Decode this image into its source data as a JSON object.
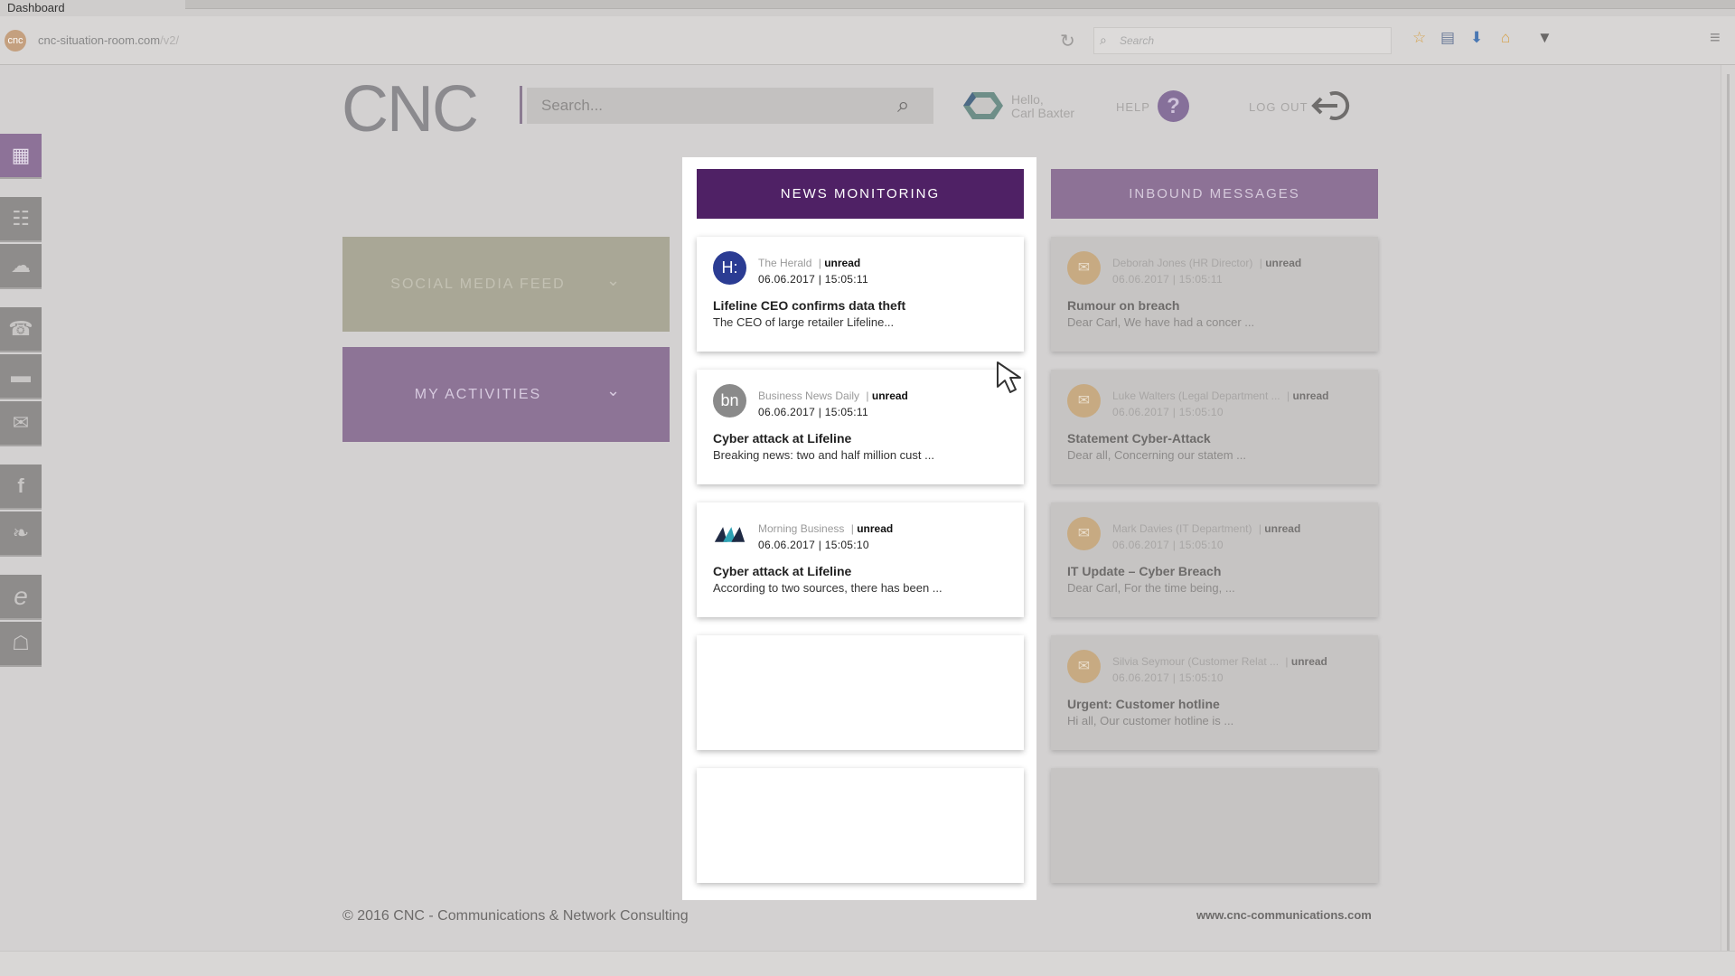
{
  "browser": {
    "window_title": "Dashboard",
    "favicon_glyph": "cnc",
    "url": "cnc-situation-room.com",
    "url_suffix": "/v2/",
    "search_placeholder": "Search"
  },
  "sidebar": {
    "items": [
      {
        "name": "dashboard-grid-icon",
        "glyph": "▦",
        "active": true
      },
      {
        "name": "document-icon",
        "glyph": "☷"
      },
      {
        "name": "cloud-upload-icon",
        "glyph": "☁"
      },
      {
        "name": "phone-icon",
        "glyph": "☎"
      },
      {
        "name": "chat-icon",
        "glyph": "▬"
      },
      {
        "name": "mail-icon",
        "glyph": "✉"
      },
      {
        "name": "facebook-icon",
        "glyph": "f"
      },
      {
        "name": "twitter-icon",
        "glyph": "❧"
      },
      {
        "name": "internet-explorer-icon",
        "glyph": "e"
      },
      {
        "name": "network-icon",
        "glyph": "☖"
      }
    ]
  },
  "header": {
    "logo": "CNC",
    "search_placeholder": "Search...",
    "greeting_line1": "Hello,",
    "greeting_line2": "Carl Baxter",
    "help_label": "HELP",
    "logout_label": "LOG OUT"
  },
  "panels": {
    "social": "SOCIAL MEDIA FEED",
    "activities": "MY ACTIVITIES"
  },
  "news": {
    "title": "NEWS MONITORING",
    "items": [
      {
        "avatar": "H:",
        "avatar_color": "#2b3c93",
        "source": "The Herald",
        "sep": "|",
        "status": "unread",
        "date": "06.06.2017 | 15:05:11",
        "headline": "Lifeline CEO confirms data theft",
        "snippet": "The CEO of large retailer Lifeline..."
      },
      {
        "avatar": "bn",
        "avatar_color": "#8a8a8a",
        "source": "Business News Daily",
        "sep": "|",
        "status": "unread",
        "date": "06.06.2017 | 15:05:11",
        "headline": "Cyber attack at Lifeline",
        "snippet": "Breaking news: two and half million cust ..."
      },
      {
        "avatar": "",
        "avatar_color": "#ffffff",
        "source": "Morning Business",
        "sep": "|",
        "status": "unread",
        "date": "06.06.2017 | 15:05:10",
        "headline": "Cyber attack at Lifeline",
        "snippet": "According to two sources, there has been ..."
      }
    ]
  },
  "inbound": {
    "title": "INBOUND MESSAGES",
    "items": [
      {
        "sender": "Deborah Jones (HR Director)",
        "sep": "|",
        "status": "unread",
        "date": "06.06.2017 | 15:05:11",
        "subject": "Rumour on breach",
        "snippet": "Dear Carl, We have had a concer ..."
      },
      {
        "sender": "Luke Walters (Legal Department ...",
        "sep": "|",
        "status": "unread",
        "date": "06.06.2017 | 15:05:10",
        "subject": "Statement Cyber-Attack",
        "snippet": "Dear all, Concerning our statem ..."
      },
      {
        "sender": "Mark Davies (IT Department)",
        "sep": "|",
        "status": "unread",
        "date": "06.06.2017 | 15:05:10",
        "subject": "IT Update – Cyber Breach",
        "snippet": "Dear Carl, For the time being, ..."
      },
      {
        "sender": "Silvia Seymour (Customer Relat ...",
        "sep": "|",
        "status": "unread",
        "date": "06.06.2017 | 15:05:10",
        "subject": "Urgent: Customer hotline",
        "snippet": "Hi all, Our customer hotline is ..."
      }
    ]
  },
  "footer": {
    "copyright": "© 2016 CNC - Communications & Network Consulting",
    "url": "www.cnc-communications.com"
  }
}
